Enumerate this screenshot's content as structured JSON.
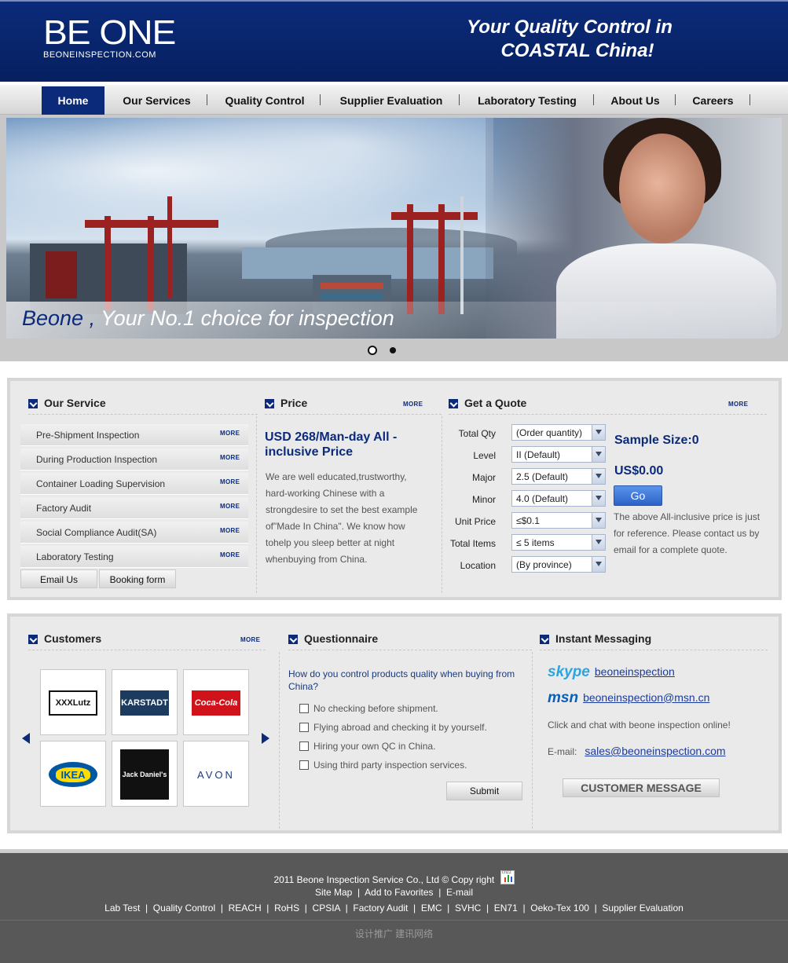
{
  "header": {
    "logo_main": "BE ONE",
    "logo_sub": "BEONEINSPECTION.COM",
    "tagline_line1": "Your Quality Control in",
    "tagline_line2": "COASTAL China!"
  },
  "nav": {
    "items": [
      {
        "label": "Home",
        "active": true
      },
      {
        "label": "Our Services"
      },
      {
        "label": "Quality Control"
      },
      {
        "label": "Supplier Evaluation"
      },
      {
        "label": "Laboratory Testing"
      },
      {
        "label": "About Us"
      },
      {
        "label": "Careers"
      }
    ]
  },
  "banner": {
    "caption_brand": "Beone ,",
    "caption_text": " Your No.1 choice for inspection"
  },
  "our_service": {
    "title": "Our Service",
    "more": "MORE",
    "items": [
      "Pre-Shipment Inspection",
      "During Production Inspection",
      "Container Loading Supervision",
      "Factory Audit",
      "Social Compliance Audit(SA)",
      "Laboratory Testing"
    ],
    "email_button": "Email Us",
    "booking_button": "Booking form"
  },
  "price": {
    "title": "Price",
    "more": "MORE",
    "headline": "USD 268/Man-day All - inclusive Price",
    "description": "We are well educated,trustworthy, hard-working Chinese with a strongdesire to set the best example of\"Made In China\". We know how tohelp you sleep better at night whenbuying from China."
  },
  "quote": {
    "title": "Get a Quote",
    "more": "MORE",
    "fields": [
      {
        "label": "Total Qty",
        "value": "(Order quantity)"
      },
      {
        "label": "Level",
        "value": "II  (Default)"
      },
      {
        "label": "Major",
        "value": "2.5  (Default)"
      },
      {
        "label": "Minor",
        "value": "4.0  (Default)"
      },
      {
        "label": "Unit Price",
        "value": "≤$0.1"
      },
      {
        "label": "Total Items",
        "value": "≤ 5 items"
      },
      {
        "label": "Location",
        "value": "(By province)"
      }
    ],
    "sample_size": "Sample Size:0",
    "price": "US$0.00",
    "go_button": "Go",
    "note": "The above All-inclusive price is just for reference. Please contact us by email for a complete quote."
  },
  "customers": {
    "title": "Customers",
    "more": "MORE",
    "logos": [
      {
        "name": "XXXLutz"
      },
      {
        "name": "KARSTADT"
      },
      {
        "name": "Coca-Cola"
      },
      {
        "name": "IKEA"
      },
      {
        "name": "Jack Daniel's"
      },
      {
        "name": "AVON"
      }
    ]
  },
  "questionnaire": {
    "title": "Questionnaire",
    "question": "How do you control products quality when buying from China?",
    "options": [
      "No checking before shipment.",
      "Flying abroad and checking it by yourself.",
      "Hiring your own QC in China.",
      "Using third party inspection services."
    ],
    "submit": "Submit"
  },
  "im": {
    "title": "Instant Messaging",
    "skype_logo": "skype",
    "skype_id": "beoneinspection",
    "msn_logo": "msn",
    "msn_id": "beoneinspection@msn.cn",
    "note": "Click and chat with beone inspection online!",
    "email_label": "E-mail:",
    "email": "sales@beoneinspection.com",
    "message_button": "CUSTOMER MESSAGE"
  },
  "footer": {
    "copyright": "2011 Beone Inspection Service Co., Ltd © Copy right",
    "stat_label": "cnzz",
    "links1": [
      "Site Map",
      "Add to Favorites",
      "E-mail"
    ],
    "links2": [
      "Lab Test",
      "Quality Control",
      "REACH",
      "RoHS",
      "CPSIA",
      "Factory Audit",
      "EMC",
      "SVHC",
      "EN71",
      "Oeko-Tex 100",
      "Supplier Evaluation"
    ],
    "credit": "设计推广  建讯网络"
  },
  "colors": {
    "brand_blue": "#0b2a7a",
    "footer_bg": "#585858",
    "panel_bg": "#eaeaea"
  }
}
